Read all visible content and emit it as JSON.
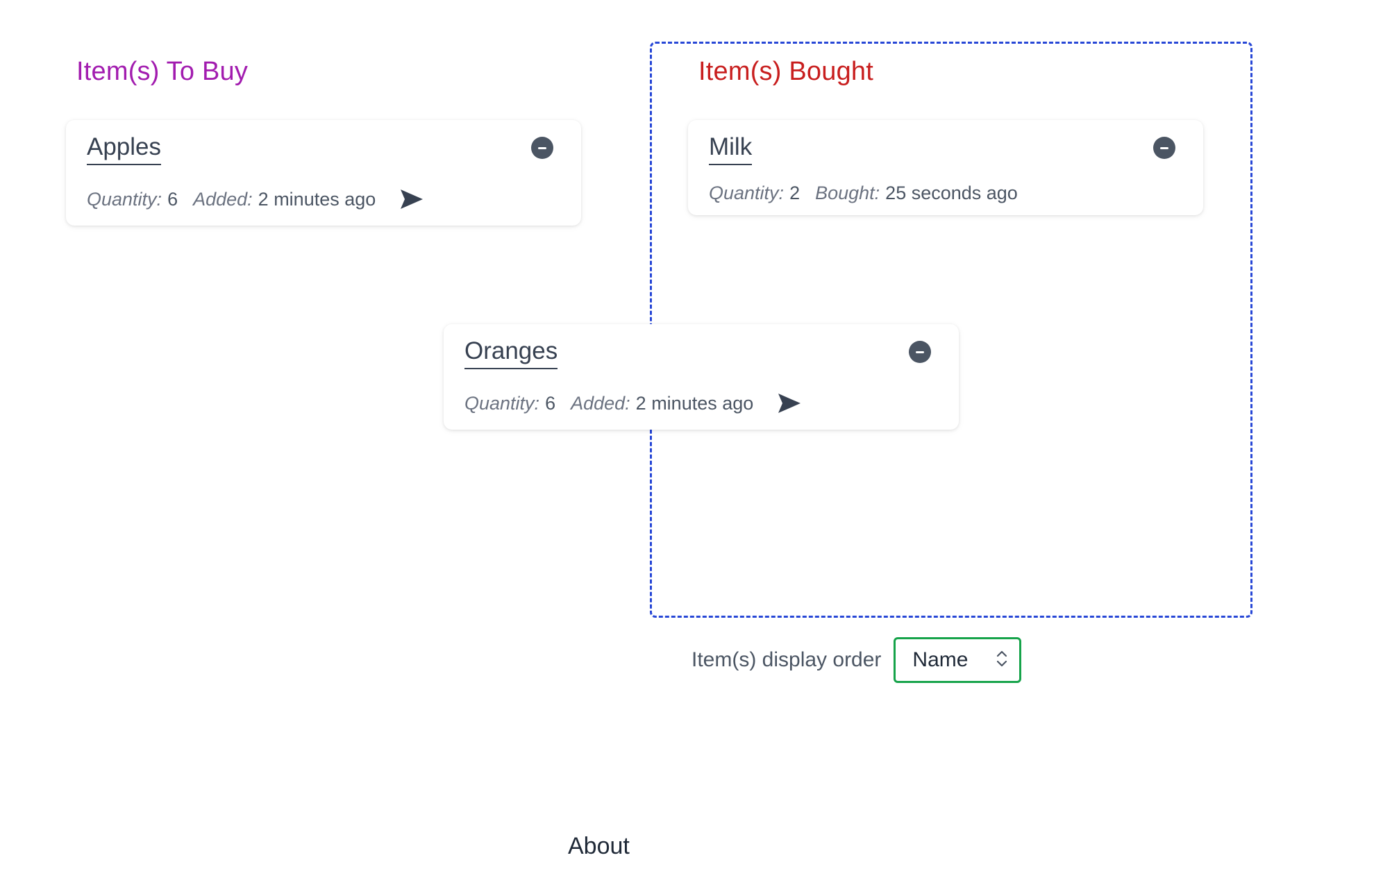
{
  "to_buy": {
    "title": "Item(s) To Buy",
    "items": [
      {
        "name": "Apples",
        "quantity_label": "Quantity:",
        "quantity": "6",
        "time_label": "Added:",
        "time_value": "2 minutes ago"
      }
    ]
  },
  "bought": {
    "title": "Item(s) Bought",
    "items": [
      {
        "name": "Milk",
        "quantity_label": "Quantity:",
        "quantity": "2",
        "time_label": "Bought:",
        "time_value": "25 seconds ago"
      }
    ]
  },
  "dragging": {
    "name": "Oranges",
    "quantity_label": "Quantity:",
    "quantity": "6",
    "time_label": "Added:",
    "time_value": "2 minutes ago"
  },
  "order": {
    "label": "Item(s) display order",
    "selected": "Name"
  },
  "footer": {
    "about": "About"
  },
  "colors": {
    "to_buy_title": "#a21caf",
    "bought_title": "#c81e1e",
    "dropzone_border": "#2747d6",
    "select_border": "#16a34a"
  }
}
